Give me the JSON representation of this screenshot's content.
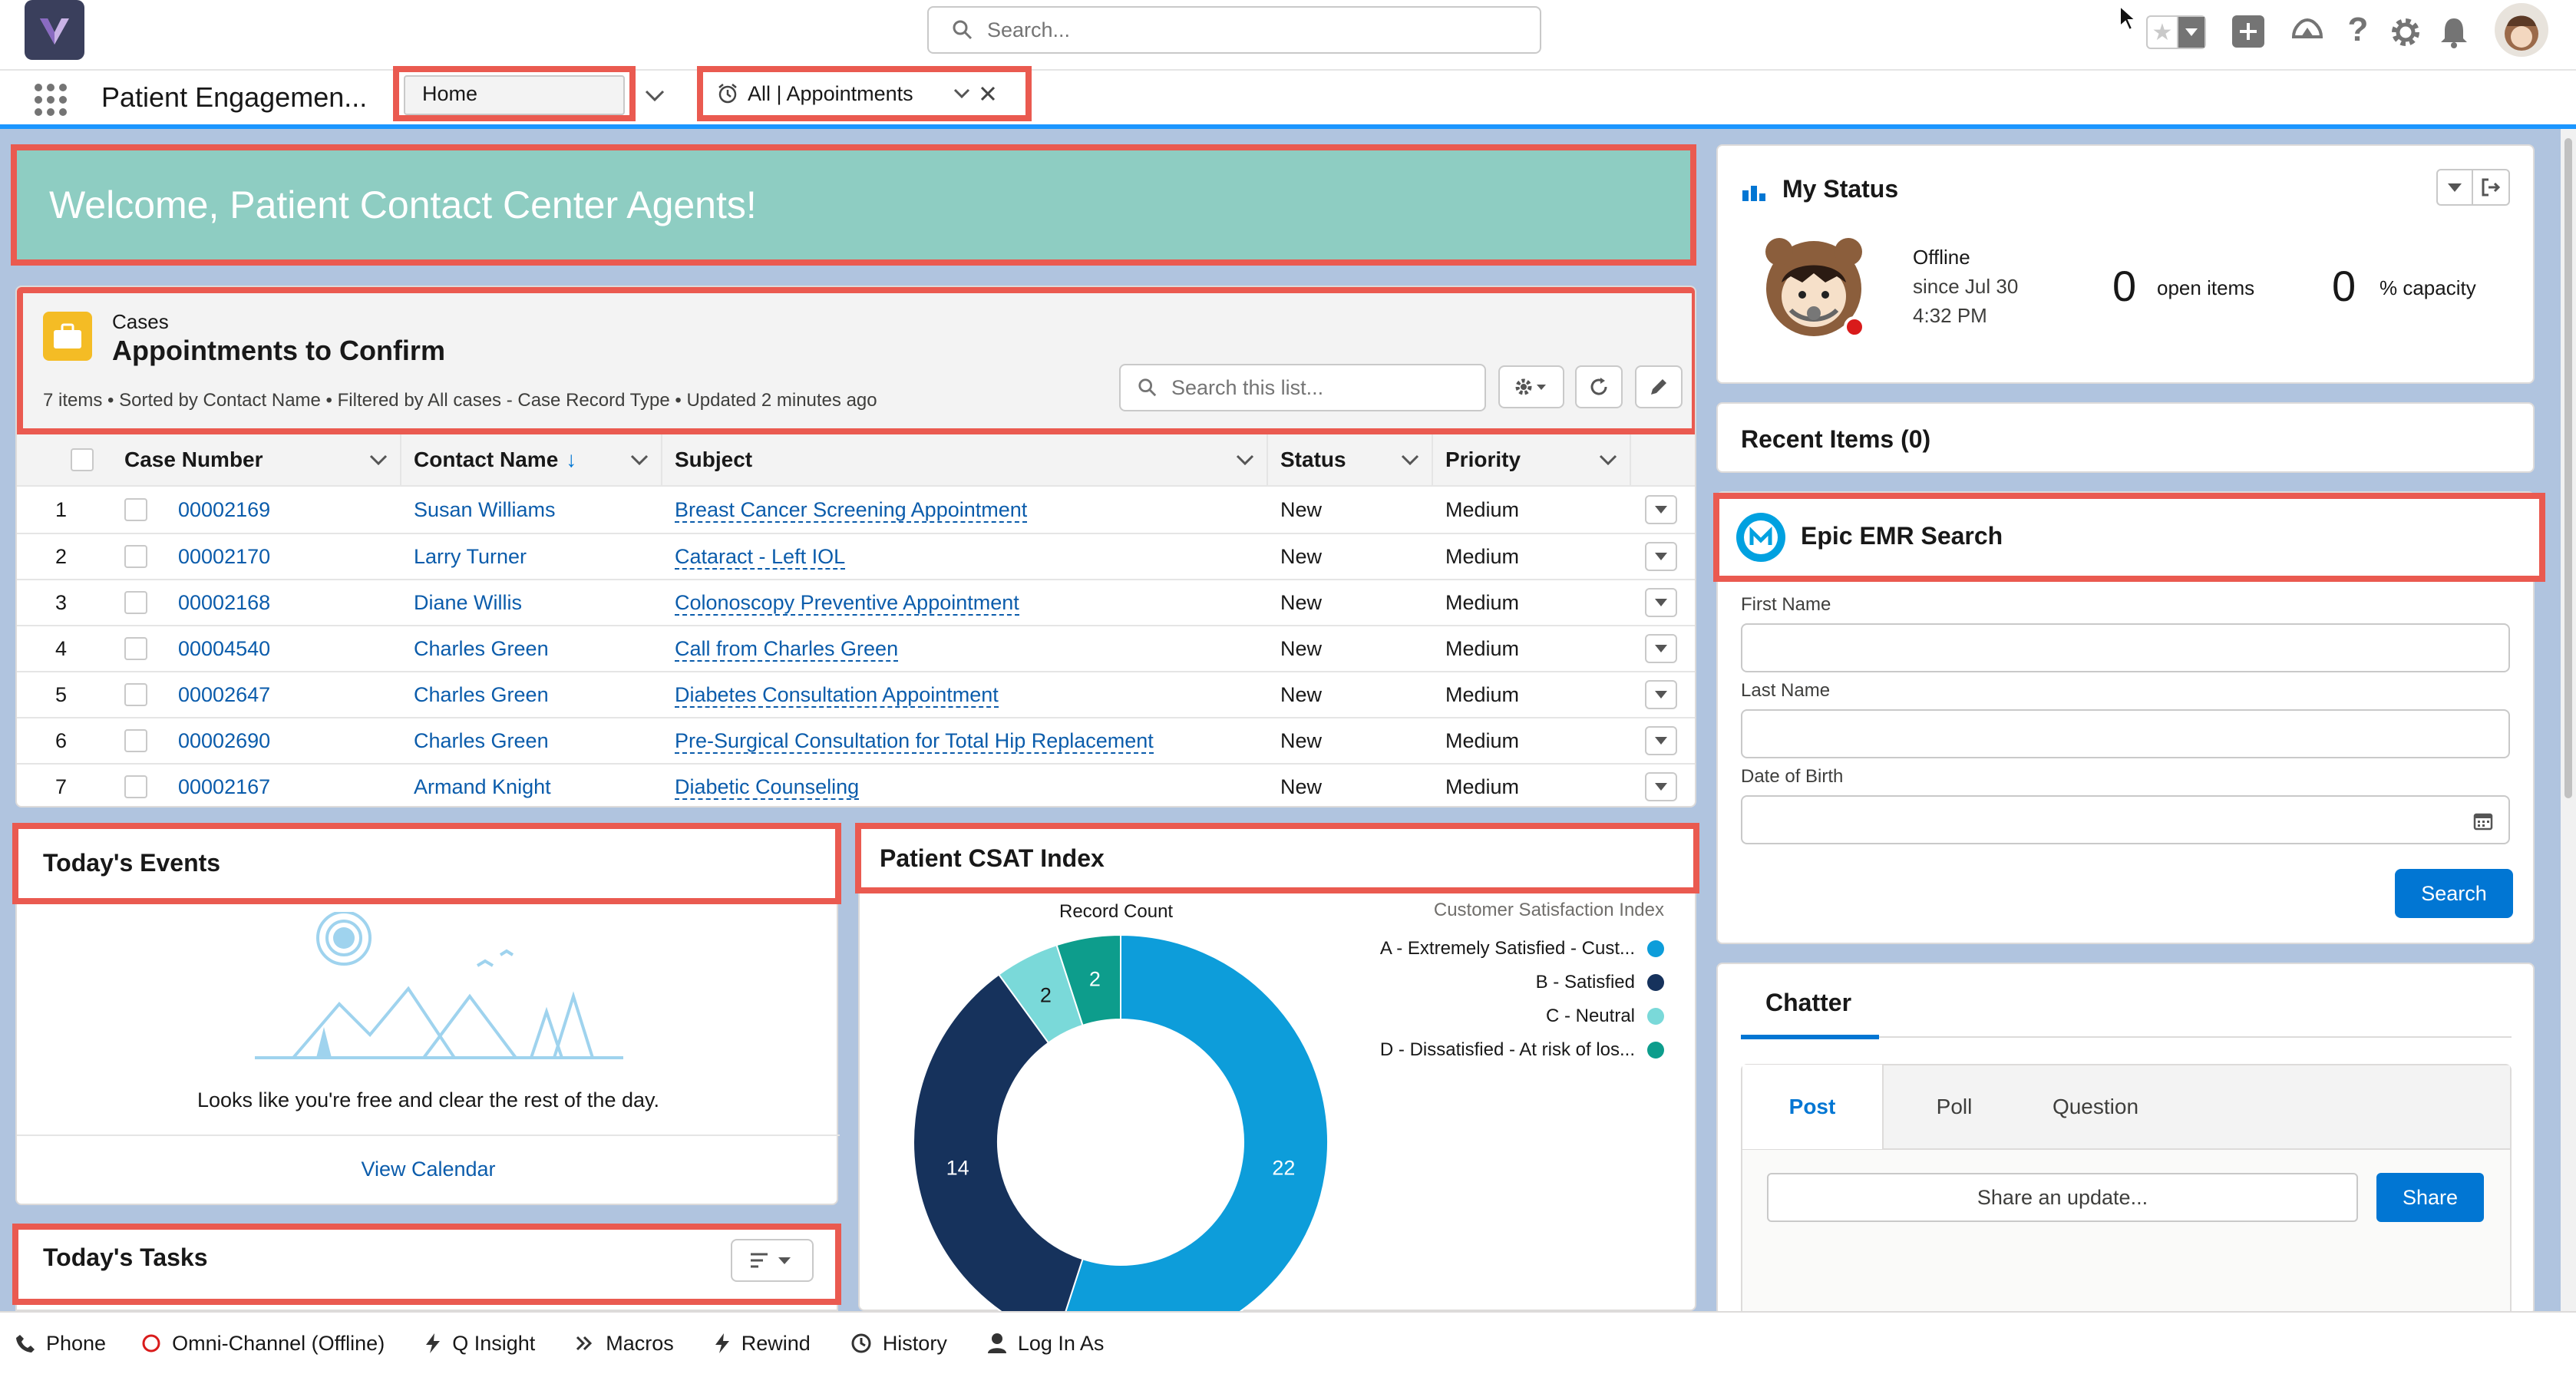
{
  "global": {
    "search_placeholder": "Search..."
  },
  "nav": {
    "app_name": "Patient Engagemen...",
    "tab_home": "Home",
    "tab_appointments": "All | Appointments"
  },
  "welcome": {
    "text": "Welcome, Patient Contact Center Agents!"
  },
  "list": {
    "object_label": "Cases",
    "title": "Appointments to Confirm",
    "meta": "7 items • Sorted by Contact Name • Filtered by All cases - Case Record Type • Updated 2 minutes ago",
    "search_placeholder": "Search this list...",
    "columns": [
      "Case Number",
      "Contact Name",
      "Subject",
      "Status",
      "Priority"
    ],
    "rows": [
      {
        "n": "1",
        "case": "00002169",
        "contact": "Susan Williams",
        "subject": "Breast Cancer Screening Appointment",
        "status": "New",
        "priority": "Medium"
      },
      {
        "n": "2",
        "case": "00002170",
        "contact": "Larry Turner",
        "subject": "Cataract - Left IOL",
        "status": "New",
        "priority": "Medium"
      },
      {
        "n": "3",
        "case": "00002168",
        "contact": "Diane Willis",
        "subject": "Colonoscopy Preventive Appointment",
        "status": "New",
        "priority": "Medium"
      },
      {
        "n": "4",
        "case": "00004540",
        "contact": "Charles Green",
        "subject": "Call from Charles Green",
        "status": "New",
        "priority": "Medium"
      },
      {
        "n": "5",
        "case": "00002647",
        "contact": "Charles Green",
        "subject": "Diabetes Consultation Appointment",
        "status": "New",
        "priority": "Medium"
      },
      {
        "n": "6",
        "case": "00002690",
        "contact": "Charles Green",
        "subject": "Pre-Surgical Consultation for Total Hip Replacement",
        "status": "New",
        "priority": "Medium"
      },
      {
        "n": "7",
        "case": "00002167",
        "contact": "Armand Knight",
        "subject": "Diabetic Counseling",
        "status": "New",
        "priority": "Medium"
      }
    ]
  },
  "events": {
    "title": "Today's Events",
    "empty_text": "Looks like you're free and clear the rest of the day.",
    "view_calendar": "View Calendar"
  },
  "tasks": {
    "title": "Today's Tasks"
  },
  "csat": {
    "title": "Patient CSAT Index",
    "record_count_label": "Record Count",
    "legend_title": "Customer Satisfaction Index"
  },
  "chart_data": {
    "type": "pie",
    "title": "Record Count",
    "legend_title": "Customer Satisfaction Index",
    "donut": true,
    "categories": [
      "A - Extremely Satisfied - Cust...",
      "B - Satisfied",
      "C - Neutral",
      "D - Dissatisfied - At risk of los..."
    ],
    "values": [
      22,
      14,
      2,
      2
    ],
    "colors": [
      "#0d9dda",
      "#16325c",
      "#7ad9d9",
      "#0d9d8c"
    ],
    "legend_position": "top-right"
  },
  "status": {
    "title": "My Status",
    "state": "Offline",
    "since_line1": "since Jul 30",
    "since_line2": "4:32 PM",
    "open_items_value": "0",
    "open_items_label": "open items",
    "capacity_value": "0",
    "capacity_label": "% capacity"
  },
  "recent": {
    "title": "Recent Items (0)"
  },
  "emr": {
    "title": "Epic EMR Search",
    "first_name": "First Name",
    "last_name": "Last Name",
    "dob": "Date of Birth",
    "search_button": "Search"
  },
  "chatter": {
    "title": "Chatter",
    "tab_post": "Post",
    "tab_poll": "Poll",
    "tab_question": "Question",
    "share_placeholder": "Share an update...",
    "share_button": "Share"
  },
  "utility": {
    "phone": "Phone",
    "omni": "Omni-Channel (Offline)",
    "insight": "Q Insight",
    "macros": "Macros",
    "rewind": "Rewind",
    "history": "History",
    "login_as": "Log In As"
  },
  "colors": {
    "brand_blue": "#0176d3",
    "welcome_bg": "#8ecdc2",
    "highlight": "#ea5a50",
    "link": "#0b5cab"
  }
}
